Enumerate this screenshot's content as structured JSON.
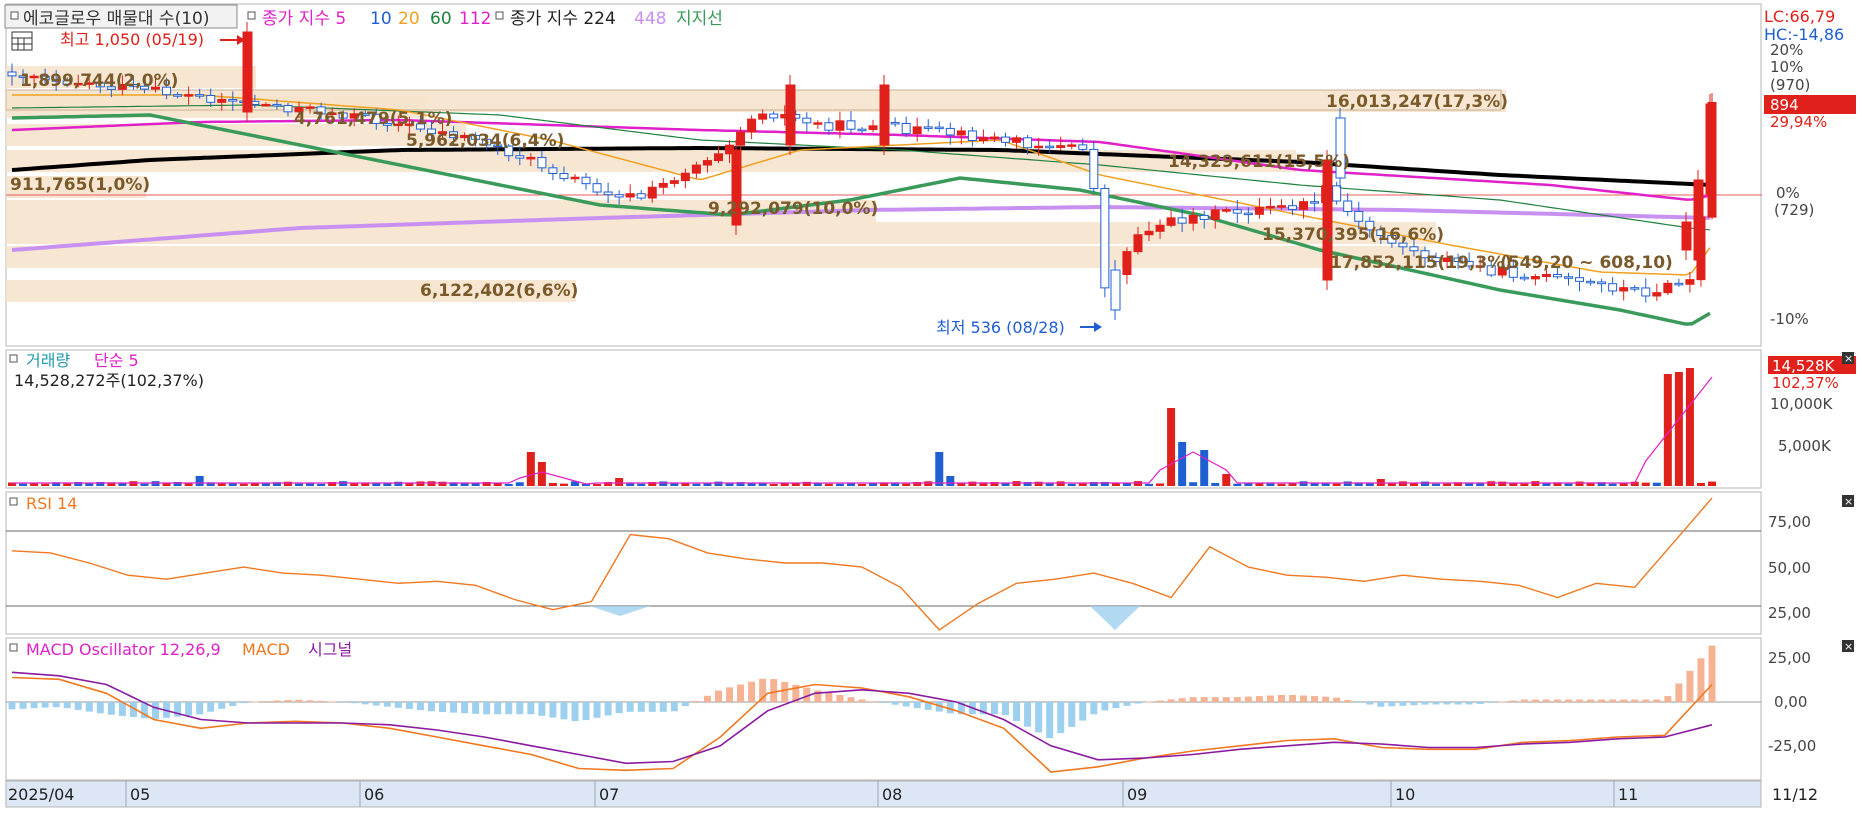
{
  "price_legend": {
    "indicator_name": "에코글로우 매물대 수(10)",
    "ema_label": "종가 지수 5",
    "ema_10": "10",
    "ema_20": "20",
    "ema_60": "60",
    "ema_112": "112",
    "ema2_label": "종가 지수 224",
    "ema_448": "448",
    "support_label": "지지선"
  },
  "price_annotations": {
    "high": "최고 1,050 (05/19)",
    "low": "최저 536 (08/28)",
    "lc": "LC:66,79",
    "hc": "HC:-14,86"
  },
  "price_axis": {
    "ticks": [
      "20%",
      "10%",
      "(970)",
      "0%",
      "(729)",
      "-10%"
    ],
    "current_price": "894",
    "current_pct": "29,94%"
  },
  "volume_profile": [
    "1,899,744(2,0%)",
    "4,761,479(5,1%)",
    "5,962,034(6,4%)",
    "16,013,247(17,3%)",
    "14,329,611(15,5%)",
    "911,765(1,0%)",
    "9,292,079(10,0%)",
    "15,370,395(16,6%)",
    "17,852,115(19,3%)",
    "6,122,402(6,6%)"
  ],
  "range_label": "(549,20 ~ 608,10)",
  "volume_legend": {
    "title": "거래량",
    "ma_label": "단순 5",
    "value": "14,528,272주(102,37%)"
  },
  "volume_axis": {
    "ticks": [
      "10,000K",
      "5,000K"
    ],
    "current": "14,528K",
    "current_pct": "102,37%"
  },
  "rsi_legend": {
    "title": "RSI 14"
  },
  "rsi_axis": {
    "ticks": [
      "75,00",
      "50,00",
      "25,00"
    ]
  },
  "macd_legend": {
    "title": "MACD Oscillator 12,26,9",
    "macd": "MACD",
    "signal": "시그널"
  },
  "macd_axis": {
    "ticks": [
      "25,00",
      "0,00",
      "-25,00"
    ]
  },
  "x_axis": {
    "labels": [
      "2025/04",
      "05",
      "06",
      "07",
      "08",
      "09",
      "10",
      "11",
      "11/12"
    ]
  },
  "colors": {
    "up": "#e0201a",
    "down": "#1f5fd1",
    "ema5": "#e020c8",
    "ema20": "#f0a020",
    "ema60": "#208040",
    "ema224": "#000000",
    "ema448": "#c890f0",
    "support": "#3a9a5a",
    "profile": "#f6e3cc",
    "rsi": "#f07820",
    "macd_pos": "#f6b394",
    "macd_neg": "#9dd0ee"
  },
  "chart_data": [
    {
      "type": "candlestick",
      "title": "에코글로우 매물대 수(10)",
      "x_range": [
        "2025/04",
        "11/12"
      ],
      "y_range_pct": [
        -10,
        20
      ],
      "high": {
        "label": "최고",
        "value": 1050,
        "date": "05/19"
      },
      "low": {
        "label": "최저",
        "value": 536,
        "date": "08/28"
      },
      "last_price": 894,
      "last_change_pct": 29.94,
      "approx_close_path": [
        {
          "month": "04",
          "value": 1000
        },
        {
          "month": "05",
          "value": 960
        },
        {
          "month": "06",
          "value": 880
        },
        {
          "month": "07",
          "value": 720
        },
        {
          "month": "07-late",
          "value": 880
        },
        {
          "month": "08",
          "value": 830
        },
        {
          "month": "08-late",
          "value": 560
        },
        {
          "month": "09",
          "value": 720
        },
        {
          "month": "09-late",
          "value": 850
        },
        {
          "month": "10",
          "value": 700
        },
        {
          "month": "11",
          "value": 650
        },
        {
          "month": "11/12",
          "value": 894
        }
      ]
    },
    {
      "type": "bar",
      "title": "거래량",
      "value_label": "14,528,272주(102,37%)",
      "last_value_k": 14528
    },
    {
      "type": "line",
      "title": "RSI 14",
      "ylim": [
        15,
        85
      ],
      "gridlines": [
        75,
        50,
        25
      ],
      "approx_values": [
        56,
        55,
        50,
        44,
        42,
        45,
        48,
        45,
        44,
        42,
        40,
        41,
        39,
        32,
        27,
        31,
        64,
        62,
        55,
        52,
        50,
        50,
        48,
        38,
        17,
        30,
        40,
        42,
        45,
        40,
        33,
        58,
        48,
        44,
        43,
        41,
        44,
        42,
        41,
        39,
        33,
        40,
        38,
        60,
        82
      ]
    },
    {
      "type": "bar",
      "title": "MACD Oscillator 12,26,9",
      "series": [
        {
          "name": "MACD",
          "approx_values": [
            14,
            13,
            5,
            -10,
            -15,
            -12,
            -11,
            -12,
            -15,
            -20,
            -25,
            -30,
            -38,
            -39,
            -38,
            -20,
            5,
            10,
            8,
            3,
            -5,
            -15,
            -40,
            -37,
            -32,
            -28,
            -25,
            -22,
            -21,
            -26,
            -27,
            -27,
            -23,
            -22,
            -20,
            -19,
            10
          ]
        },
        {
          "name": "시그널",
          "approx_values": [
            17,
            15,
            10,
            -3,
            -10,
            -12,
            -12,
            -12,
            -13,
            -16,
            -20,
            -25,
            -30,
            -35,
            -34,
            -25,
            -5,
            5,
            7,
            5,
            0,
            -10,
            -25,
            -33,
            -32,
            -30,
            -27,
            -25,
            -23,
            -24,
            -26,
            -26,
            -24,
            -23,
            -21,
            -20,
            -13
          ]
        }
      ]
    }
  ]
}
